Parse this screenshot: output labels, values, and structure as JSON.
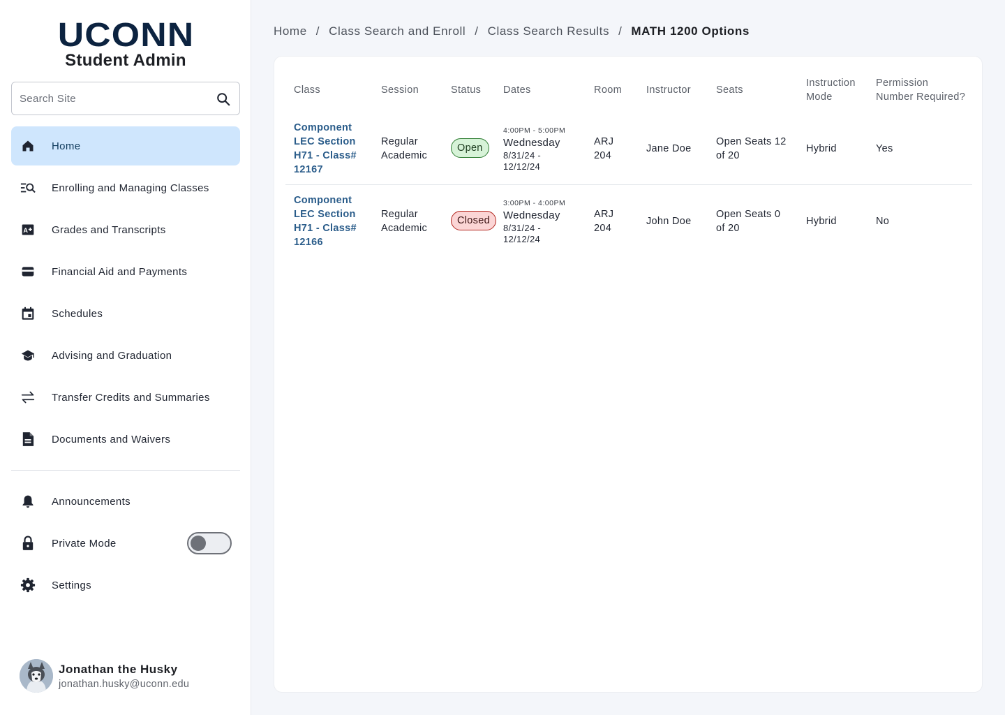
{
  "logo": {
    "main": "UCONN",
    "sub": "Student Admin"
  },
  "search": {
    "placeholder": "Search Site"
  },
  "nav": {
    "items": [
      {
        "label": "Home",
        "icon": "home-icon",
        "active": true
      },
      {
        "label": "Enrolling and Managing Classes",
        "icon": "list-search-icon"
      },
      {
        "label": "Grades and Transcripts",
        "icon": "grade-icon"
      },
      {
        "label": "Financial Aid and Payments",
        "icon": "wallet-icon"
      },
      {
        "label": "Schedules",
        "icon": "calendar-icon"
      },
      {
        "label": "Advising and Graduation",
        "icon": "graduation-cap-icon"
      },
      {
        "label": "Transfer Credits and Summaries",
        "icon": "transfer-icon"
      },
      {
        "label": "Documents and Waivers",
        "icon": "document-icon"
      }
    ],
    "secondary": [
      {
        "label": "Announcements",
        "icon": "bell-icon"
      },
      {
        "label": "Private Mode",
        "icon": "lock-icon",
        "toggle": false
      },
      {
        "label": "Settings",
        "icon": "gear-icon"
      }
    ]
  },
  "user": {
    "name": "Jonathan the Husky",
    "email": "jonathan.husky@uconn.edu"
  },
  "breadcrumb": {
    "items": [
      "Home",
      "Class Search and Enroll",
      "Class Search Results"
    ],
    "current": "MATH 1200 Options",
    "separator": "/"
  },
  "table": {
    "headers": {
      "class": "Class",
      "session": "Session",
      "status": "Status",
      "dates": "Dates",
      "room": "Room",
      "instructor": "Instructor",
      "seats": "Seats",
      "instruction_mode_1": "Instruction",
      "instruction_mode_2": "Mode",
      "permission_1": "Permission",
      "permission_2": "Number Required?"
    },
    "rows": [
      {
        "class_lines": [
          "Component",
          "LEC Section",
          "H71 - Class#",
          "12167"
        ],
        "session_lines": [
          "Regular",
          "Academic"
        ],
        "status": "Open",
        "status_color": "#2e7d32",
        "time": "4:00PM - 5:00PM",
        "day": "Wednesday",
        "date_lines": [
          "8/31/24 -",
          "12/12/24"
        ],
        "room_lines": [
          "ARJ",
          "204"
        ],
        "instructor": "Jane Doe",
        "seats_lines": [
          "Open Seats 12",
          "of 20"
        ],
        "mode": "Hybrid",
        "permission": "Yes"
      },
      {
        "class_lines": [
          "Component",
          "LEC Section",
          "H71 - Class#",
          "12166"
        ],
        "session_lines": [
          "Regular",
          "Academic"
        ],
        "status": "Closed",
        "status_color": "#b3261e",
        "time": "3:00PM - 4:00PM",
        "day": "Wednesday",
        "date_lines": [
          "8/31/24 -",
          "12/12/24"
        ],
        "room_lines": [
          "ARJ",
          "204"
        ],
        "instructor": "John Doe",
        "seats_lines": [
          "Open Seats 0",
          "of 20"
        ],
        "mode": "Hybrid",
        "permission": "No"
      }
    ]
  },
  "colors": {
    "brand_navy": "#0c2340",
    "active_nav": "#cfe6fd",
    "link": "#2a5c8a"
  }
}
